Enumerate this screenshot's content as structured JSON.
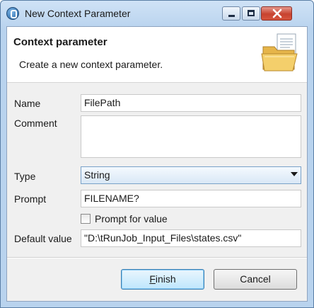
{
  "window": {
    "title": "New Context Parameter",
    "icon": "talend-app-icon",
    "controls": {
      "minimize_icon": "minimize-icon",
      "maximize_icon": "maximize-icon",
      "close_icon": "close-icon"
    }
  },
  "header": {
    "title": "Context parameter",
    "description": "Create a new context parameter.",
    "icon": "folder-document-icon"
  },
  "form": {
    "name": {
      "label": "Name",
      "value": "FilePath"
    },
    "comment": {
      "label": "Comment",
      "value": ""
    },
    "type": {
      "label": "Type",
      "value": "String"
    },
    "prompt": {
      "label": "Prompt",
      "value": "FILENAME?"
    },
    "prompt_for_value": {
      "label": "Prompt for value",
      "checked": false
    },
    "default_value": {
      "label": "Default value",
      "value": "\"D:\\tRunJob_Input_Files\\states.csv\""
    }
  },
  "buttons": {
    "finish_first": "F",
    "finish_rest": "inish",
    "cancel": "Cancel"
  },
  "colors": {
    "titlebar": "#b9d3ee",
    "close_button": "#c7432f",
    "primary_button": "#bee6fd"
  }
}
